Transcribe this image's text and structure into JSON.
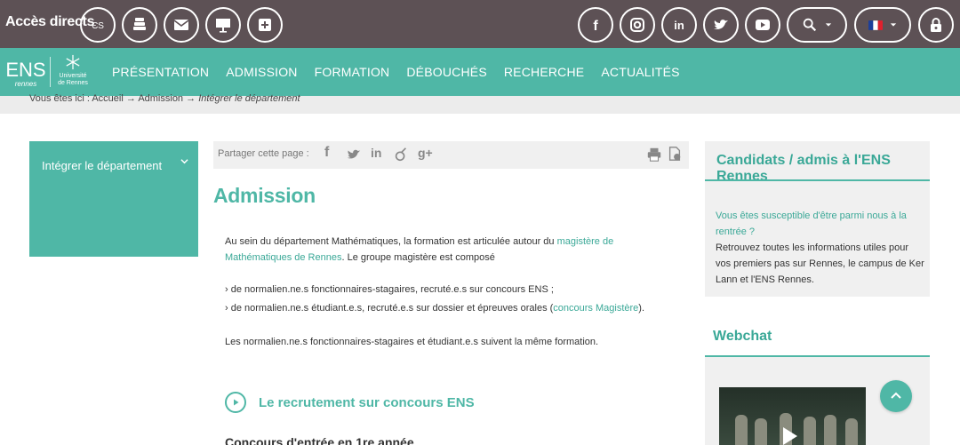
{
  "topbar": {
    "acces_label": "Accès directs",
    "quick_links": [
      "ens-rennes-icon",
      "books-icon",
      "mail-icon",
      "presentation-board-icon",
      "plus-square-icon"
    ],
    "social": [
      "facebook-icon",
      "instagram-icon",
      "linkedin-icon",
      "twitter-icon",
      "youtube-icon"
    ],
    "search_icon": "search-icon",
    "language_icon": "french-flag-icon",
    "lock_icon": "lock-icon"
  },
  "logo": {
    "ens_text": "ENS",
    "ens_sub": "rennes",
    "ur_text": "Université de Rennes"
  },
  "nav": {
    "items": [
      "PRÉSENTATION",
      "ADMISSION",
      "FORMATION",
      "DÉBOUCHÉS",
      "RECHERCHE",
      "ACTUALITÉS"
    ]
  },
  "breadcrumb": {
    "prefix": "Vous êtes ici :",
    "home": "Accueil",
    "arrow": "→",
    "section": "Admission",
    "current": "Intégrer le département"
  },
  "sidebar": {
    "item_label": "Intégrer le département"
  },
  "share": {
    "label": "Partager cette page :"
  },
  "main": {
    "title": "Admission",
    "intro_a": "Au sein du département Mathématiques, la formation est articulée autour du ",
    "intro_link": "magistère de Mathématiques de Rennes",
    "intro_b": ". Le groupe magistère est composé",
    "bullet1": "› de normalien.ne.s fonctionnaires-stagaires, recruté.e.s sur concours ENS ;",
    "bullet2_a": "› de normalien.ne.s étudiant.e.s, recruté.e.s sur dossier et épreuves orales (",
    "bullet2_link": "concours Magistère",
    "bullet2_b": ").",
    "para2": "Les normalien.ne.s fonctionnaires-stagaires et étudiant.e.s suivent la même formation.",
    "section_title": "Le recrutement sur concours ENS",
    "cut_heading": "Concours d'entrée en 1re année"
  },
  "right": {
    "box_title": "Candidats / admis à l'ENS Rennes",
    "box_link": "Vous êtes susceptible d'être parmi nous à la rentrée ?",
    "box_text": "Retrouvez toutes les informations utiles pour vos premiers pas sur Rennes, le campus de Ker Lann et l'ENS Rennes.",
    "webchat_title": "Webchat"
  },
  "colors": {
    "accent": "#4fb7a6",
    "topbar": "#5d5155",
    "link": "#3aa897"
  }
}
